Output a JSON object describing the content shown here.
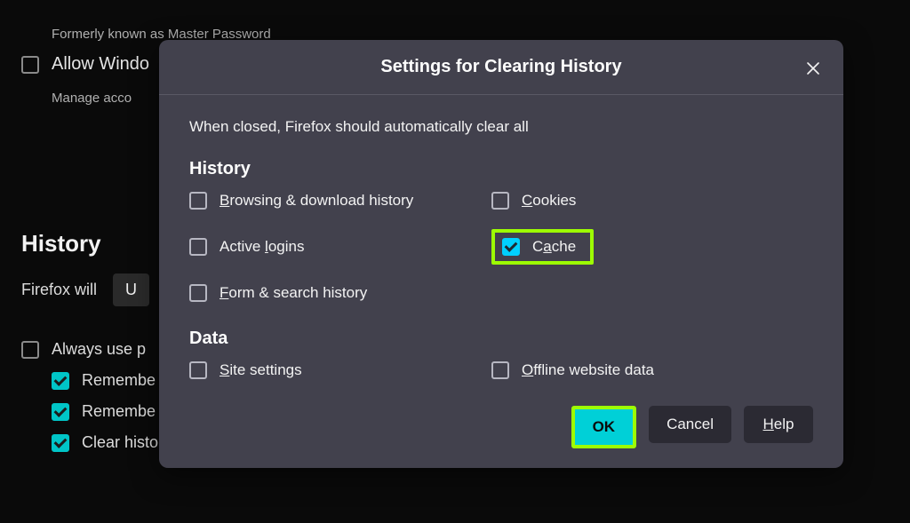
{
  "bg": {
    "note": "Formerly known as Master Password",
    "allow": "Allow Windo",
    "manage": "Manage acco",
    "historyHeading": "History",
    "willPrefix": "Firefox will",
    "willValue": "U",
    "alwaysPrivate": "Always use p",
    "remember1": "Remembe",
    "remember2": "Remembe",
    "clearHist": "Clear histo"
  },
  "dialog": {
    "title": "Settings for Clearing History",
    "intro": "When closed, Firefox should automatically clear all",
    "sectionHistory": "History",
    "sectionData": "Data",
    "options": {
      "browsing": {
        "pre": "",
        "ak": "B",
        "post": "rowsing & download history"
      },
      "cookies": {
        "pre": "",
        "ak": "C",
        "post": "ookies"
      },
      "logins": {
        "pre": "Active ",
        "ak": "l",
        "post": "ogins"
      },
      "cache": {
        "pre": "C",
        "ak": "a",
        "post": "che"
      },
      "form": {
        "pre": "",
        "ak": "F",
        "post": "orm & search history"
      },
      "site": {
        "pre": "",
        "ak": "S",
        "post": "ite settings"
      },
      "offline": {
        "pre": "",
        "ak": "O",
        "post": "ffline website data"
      }
    },
    "ok": "OK",
    "cancel": "Cancel",
    "help": {
      "ak": "H",
      "post": "elp"
    }
  }
}
